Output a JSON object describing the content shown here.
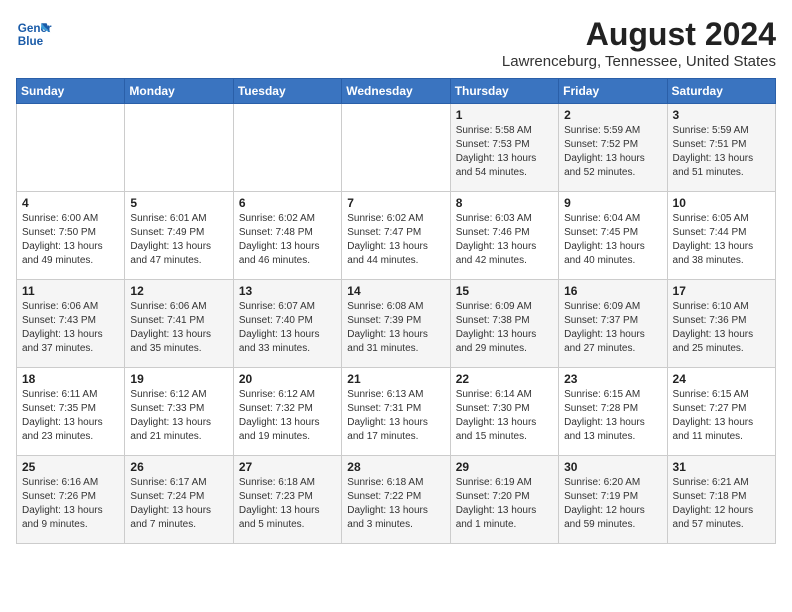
{
  "logo": {
    "line1": "General",
    "line2": "Blue"
  },
  "title": "August 2024",
  "location": "Lawrenceburg, Tennessee, United States",
  "days_of_week": [
    "Sunday",
    "Monday",
    "Tuesday",
    "Wednesday",
    "Thursday",
    "Friday",
    "Saturday"
  ],
  "weeks": [
    [
      {
        "day": "",
        "info": ""
      },
      {
        "day": "",
        "info": ""
      },
      {
        "day": "",
        "info": ""
      },
      {
        "day": "",
        "info": ""
      },
      {
        "day": "1",
        "info": "Sunrise: 5:58 AM\nSunset: 7:53 PM\nDaylight: 13 hours\nand 54 minutes."
      },
      {
        "day": "2",
        "info": "Sunrise: 5:59 AM\nSunset: 7:52 PM\nDaylight: 13 hours\nand 52 minutes."
      },
      {
        "day": "3",
        "info": "Sunrise: 5:59 AM\nSunset: 7:51 PM\nDaylight: 13 hours\nand 51 minutes."
      }
    ],
    [
      {
        "day": "4",
        "info": "Sunrise: 6:00 AM\nSunset: 7:50 PM\nDaylight: 13 hours\nand 49 minutes."
      },
      {
        "day": "5",
        "info": "Sunrise: 6:01 AM\nSunset: 7:49 PM\nDaylight: 13 hours\nand 47 minutes."
      },
      {
        "day": "6",
        "info": "Sunrise: 6:02 AM\nSunset: 7:48 PM\nDaylight: 13 hours\nand 46 minutes."
      },
      {
        "day": "7",
        "info": "Sunrise: 6:02 AM\nSunset: 7:47 PM\nDaylight: 13 hours\nand 44 minutes."
      },
      {
        "day": "8",
        "info": "Sunrise: 6:03 AM\nSunset: 7:46 PM\nDaylight: 13 hours\nand 42 minutes."
      },
      {
        "day": "9",
        "info": "Sunrise: 6:04 AM\nSunset: 7:45 PM\nDaylight: 13 hours\nand 40 minutes."
      },
      {
        "day": "10",
        "info": "Sunrise: 6:05 AM\nSunset: 7:44 PM\nDaylight: 13 hours\nand 38 minutes."
      }
    ],
    [
      {
        "day": "11",
        "info": "Sunrise: 6:06 AM\nSunset: 7:43 PM\nDaylight: 13 hours\nand 37 minutes."
      },
      {
        "day": "12",
        "info": "Sunrise: 6:06 AM\nSunset: 7:41 PM\nDaylight: 13 hours\nand 35 minutes."
      },
      {
        "day": "13",
        "info": "Sunrise: 6:07 AM\nSunset: 7:40 PM\nDaylight: 13 hours\nand 33 minutes."
      },
      {
        "day": "14",
        "info": "Sunrise: 6:08 AM\nSunset: 7:39 PM\nDaylight: 13 hours\nand 31 minutes."
      },
      {
        "day": "15",
        "info": "Sunrise: 6:09 AM\nSunset: 7:38 PM\nDaylight: 13 hours\nand 29 minutes."
      },
      {
        "day": "16",
        "info": "Sunrise: 6:09 AM\nSunset: 7:37 PM\nDaylight: 13 hours\nand 27 minutes."
      },
      {
        "day": "17",
        "info": "Sunrise: 6:10 AM\nSunset: 7:36 PM\nDaylight: 13 hours\nand 25 minutes."
      }
    ],
    [
      {
        "day": "18",
        "info": "Sunrise: 6:11 AM\nSunset: 7:35 PM\nDaylight: 13 hours\nand 23 minutes."
      },
      {
        "day": "19",
        "info": "Sunrise: 6:12 AM\nSunset: 7:33 PM\nDaylight: 13 hours\nand 21 minutes."
      },
      {
        "day": "20",
        "info": "Sunrise: 6:12 AM\nSunset: 7:32 PM\nDaylight: 13 hours\nand 19 minutes."
      },
      {
        "day": "21",
        "info": "Sunrise: 6:13 AM\nSunset: 7:31 PM\nDaylight: 13 hours\nand 17 minutes."
      },
      {
        "day": "22",
        "info": "Sunrise: 6:14 AM\nSunset: 7:30 PM\nDaylight: 13 hours\nand 15 minutes."
      },
      {
        "day": "23",
        "info": "Sunrise: 6:15 AM\nSunset: 7:28 PM\nDaylight: 13 hours\nand 13 minutes."
      },
      {
        "day": "24",
        "info": "Sunrise: 6:15 AM\nSunset: 7:27 PM\nDaylight: 13 hours\nand 11 minutes."
      }
    ],
    [
      {
        "day": "25",
        "info": "Sunrise: 6:16 AM\nSunset: 7:26 PM\nDaylight: 13 hours\nand 9 minutes."
      },
      {
        "day": "26",
        "info": "Sunrise: 6:17 AM\nSunset: 7:24 PM\nDaylight: 13 hours\nand 7 minutes."
      },
      {
        "day": "27",
        "info": "Sunrise: 6:18 AM\nSunset: 7:23 PM\nDaylight: 13 hours\nand 5 minutes."
      },
      {
        "day": "28",
        "info": "Sunrise: 6:18 AM\nSunset: 7:22 PM\nDaylight: 13 hours\nand 3 minutes."
      },
      {
        "day": "29",
        "info": "Sunrise: 6:19 AM\nSunset: 7:20 PM\nDaylight: 13 hours\nand 1 minute."
      },
      {
        "day": "30",
        "info": "Sunrise: 6:20 AM\nSunset: 7:19 PM\nDaylight: 12 hours\nand 59 minutes."
      },
      {
        "day": "31",
        "info": "Sunrise: 6:21 AM\nSunset: 7:18 PM\nDaylight: 12 hours\nand 57 minutes."
      }
    ]
  ]
}
